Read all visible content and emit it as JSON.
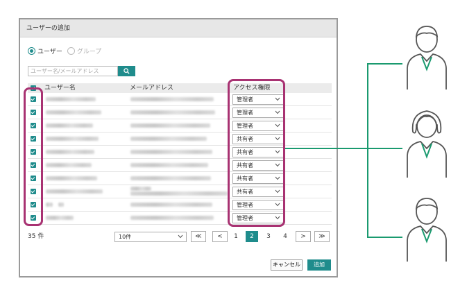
{
  "dialog": {
    "title": "ユーザーの追加",
    "radio_user": "ユーザー",
    "radio_group": "グループ",
    "search_placeholder": "ユーザー名/メールアドレス",
    "headers": {
      "name": "ユーザー名",
      "email": "メールアドレス",
      "access": "アクセス権限"
    },
    "rows": [
      {
        "access": "管理者",
        "checked": true
      },
      {
        "access": "管理者",
        "checked": true
      },
      {
        "access": "管理者",
        "checked": true
      },
      {
        "access": "共有者",
        "checked": true
      },
      {
        "access": "共有者",
        "checked": true
      },
      {
        "access": "共有者",
        "checked": true
      },
      {
        "access": "共有者",
        "checked": true
      },
      {
        "access": "共有者",
        "checked": true
      },
      {
        "access": "管理者",
        "checked": true
      },
      {
        "access": "管理者",
        "checked": true
      }
    ],
    "count": "35 件",
    "per_page": "10件",
    "pagination": {
      "first": "≪",
      "prev": "<",
      "pages": [
        "1",
        "2",
        "3",
        "4"
      ],
      "current": "2",
      "next": ">",
      "last": "≫"
    },
    "cancel_label": "キャンセル",
    "add_label": "追加"
  },
  "colors": {
    "accent": "#1f8c8c",
    "highlight": "#a83272",
    "connector": "#1a9a6f"
  },
  "icons": [
    "search-icon",
    "chevron-down-icon",
    "checkbox-checked-icon",
    "person-icon"
  ]
}
